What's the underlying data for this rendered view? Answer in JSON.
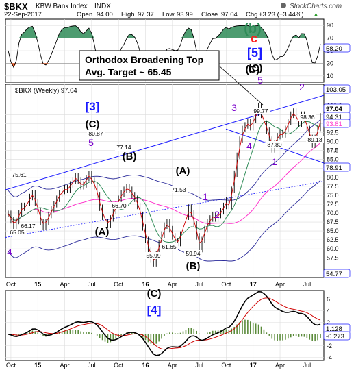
{
  "header": {
    "symbol": "$BKX",
    "name": "KBW Bank Index",
    "exchange": "INDX",
    "logo": "StockCharts.com",
    "date": "22-Sep-2017",
    "open_label": "Open",
    "open": "94.00",
    "high_label": "High",
    "high": "97.37",
    "low_label": "Low",
    "low": "93.99",
    "close_label": "Close",
    "close": "97.04",
    "chg_label": "Chg",
    "chg": "+3.23 (+3.44%)",
    "chg_arrow": "▲"
  },
  "chart_data": [
    {
      "type": "line",
      "panel": "indicator-top",
      "ylim": [
        0,
        100
      ],
      "ticks": [
        10,
        30,
        50,
        70,
        90
      ],
      "last_value": "58.20",
      "wave_labels": [
        "(b)",
        "c",
        "[5]",
        "(C)"
      ],
      "colors": {
        "line": "#000000",
        "fill_over": "#2e8b57",
        "fill_under": "#ff4500"
      }
    },
    {
      "type": "line",
      "panel": "price",
      "legend": "$BKX (Weekly) 97.04",
      "x_labels": [
        "Oct",
        "15",
        "Apr",
        "Jul",
        "Oct",
        "16",
        "Apr",
        "Jul",
        "Oct",
        "17",
        "Apr",
        "Jul"
      ],
      "ylim": [
        52,
        106
      ],
      "yticks": [
        57.5,
        60.0,
        62.5,
        65.0,
        67.5,
        70.0,
        72.5,
        75.0,
        77.5,
        80.0,
        82.5,
        85.0,
        87.5,
        90.0,
        92.5,
        95.0,
        97.5,
        100.0
      ],
      "series": [
        {
          "values": [
            69.8,
            68.0,
            66.5,
            67.8,
            70.0,
            72.0,
            71.5,
            73.0,
            74.5,
            75.6,
            73.0,
            70.5,
            67.5,
            66.2,
            67.5,
            69.5,
            71.0,
            72.5,
            74.0,
            75.5,
            76.2,
            77.0,
            76.5,
            78.0,
            79.0,
            80.3,
            79.0,
            77.5,
            78.0,
            79.8,
            80.87,
            79.0,
            77.5,
            75.0,
            71.5,
            69.0,
            67.5,
            66.7,
            68.5,
            70.5,
            72.5,
            74.0,
            75.5,
            76.5,
            77.14,
            76.5,
            75.0,
            74.0,
            72.0,
            69.5,
            66.0,
            62.5,
            59.5,
            57.0,
            55.99,
            58.5,
            61.5,
            64.0,
            66.5,
            67.5,
            65.5,
            63.5,
            62.0,
            61.65,
            64.0,
            67.0,
            69.0,
            71.53,
            70.0,
            67.0,
            63.5,
            59.94,
            62.5,
            65.5,
            67.5,
            68.5,
            69.5,
            68.5,
            69.5,
            70.5,
            72.0,
            73.5,
            72.0,
            76.5,
            81.0,
            86.0,
            90.5,
            93.5,
            94.5,
            95.5,
            94.0,
            96.0,
            98.0,
            99.77,
            97.5,
            95.0,
            93.0,
            90.5,
            87.8,
            89.5,
            91.5,
            92.5,
            92.0,
            93.5,
            95.5,
            97.5,
            98.36,
            96.5,
            95.0,
            97.5,
            96.5,
            93.5,
            91.0,
            89.13,
            91.0,
            93.81,
            97.04
          ]
        },
        {
          "name": "MA short",
          "values": []
        },
        {
          "name": "MA long",
          "values": []
        }
      ],
      "price_labels": [
        "65.05",
        "75.61",
        "66.17",
        "80.87",
        "77.14",
        "66.70",
        "71.53",
        "61.65",
        "55.99",
        "59.94",
        "99.77",
        "98.36",
        "87.80",
        "89.13"
      ],
      "axis_badges": [
        "103.05",
        "97.04",
        "94.31",
        "93.81",
        "78.91",
        "54.77"
      ],
      "wave_labels": [
        "4",
        "[3]",
        "(C)",
        "5",
        "(B)",
        "(A)",
        "(A)",
        "1",
        "2",
        "(B)",
        "(C)",
        "[4]",
        "3",
        "4",
        "5",
        "(C)",
        "2",
        "1",
        "5"
      ],
      "annotation_line1": "Orthodox Broadening Top",
      "annotation_line2": "Avg. Target ~ 65.45"
    },
    {
      "type": "line",
      "panel": "macd",
      "ylim": [
        -4.5,
        7.5
      ],
      "ticks": [
        -4,
        -2,
        0,
        2,
        4,
        6
      ],
      "last_values": [
        "1.128",
        "-0.273"
      ],
      "x_labels": [
        "Oct",
        "15",
        "Apr",
        "Jul",
        "Oct",
        "16",
        "Apr",
        "Jul",
        "Oct",
        "17",
        "Apr",
        "Jul"
      ]
    }
  ]
}
